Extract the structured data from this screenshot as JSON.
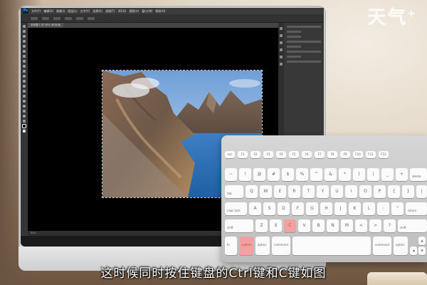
{
  "watermark": {
    "text": "天气",
    "sup": "+"
  },
  "photoshop": {
    "menu": [
      "文件(F)",
      "编辑(E)",
      "图像(I)",
      "图层(L)",
      "文字(Y)",
      "选择(S)",
      "滤镜(T)",
      "3D(D)",
      "视图(V)",
      "窗口(W)",
      "帮助(H)"
    ],
    "logo": "Ps",
    "document_tab": "未标题-1 @ 50% (RGB/8)",
    "zoom_status": "50%"
  },
  "keyboard": {
    "fn_keys": [
      "esc",
      "F1",
      "F2",
      "F3",
      "F4",
      "F5",
      "F6",
      "F7",
      "F8",
      "F9",
      "F10",
      "F11",
      "F12"
    ],
    "row1": [
      "~",
      "!",
      "@",
      "#",
      "$",
      "%",
      "^",
      "&",
      "*",
      "(",
      ")",
      "_",
      "+",
      "delete"
    ],
    "row2": [
      "tab",
      "Q",
      "W",
      "E",
      "R",
      "T",
      "Y",
      "U",
      "I",
      "O",
      "P",
      "{",
      "}",
      "|"
    ],
    "row3": [
      "caps lock",
      "A",
      "S",
      "D",
      "F",
      "G",
      "H",
      "J",
      "K",
      "L",
      ":",
      "\"",
      "return"
    ],
    "row4": [
      "shift",
      "Z",
      "X",
      "C",
      "V",
      "B",
      "N",
      "M",
      "<",
      ">",
      "?",
      "shift"
    ],
    "row5": [
      "fn",
      "control",
      "option",
      "command",
      "",
      "command",
      "option"
    ],
    "highlight_color": "#f2a0a0"
  },
  "caption": "这时候同时按住键盘的Ctrl键和C键如图"
}
